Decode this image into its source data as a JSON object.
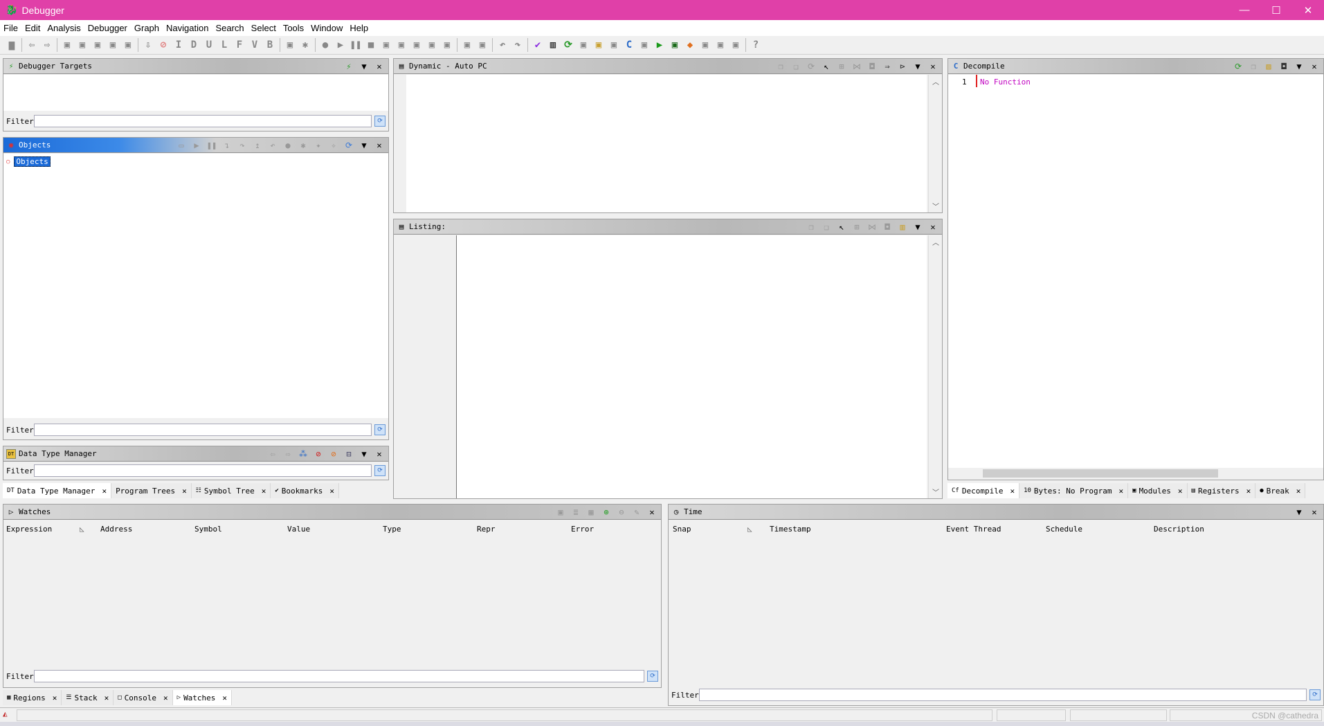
{
  "window": {
    "title": "Debugger",
    "minimize": "—",
    "maximize": "☐",
    "close": "✕"
  },
  "menu": [
    "File",
    "Edit",
    "Analysis",
    "Debugger",
    "Graph",
    "Navigation",
    "Search",
    "Select",
    "Tools",
    "Window",
    "Help"
  ],
  "toolbar": [
    "save-icon",
    "|",
    "back-icon",
    "forward-icon",
    "|",
    "program-icon",
    "program-up-icon",
    "program-down-icon",
    "program-next-icon",
    "program-prev-icon",
    "|",
    "next-arrow-icon",
    "stop-red-icon",
    "I",
    "D",
    "U",
    "L",
    "F",
    "V",
    "B",
    "|",
    "script-icon",
    "bug-icon",
    "|",
    "record-icon",
    "resume-icon",
    "pause-icon",
    "stop-icon",
    "disconnect-icon",
    "step-into-icon",
    "step-over-icon",
    "step-out-icon",
    "step-last-icon",
    "|",
    "sync-icon",
    "sync2-icon",
    "|",
    "undo-icon",
    "redo-icon",
    "|",
    "check-icon",
    "bytes-icon",
    "refresh-green-icon",
    "list-icon",
    "folder-icon",
    "table-icon",
    "decompile-icon",
    "tree-icon",
    "run-green-icon",
    "terminal-icon",
    "diamond-icon",
    "grid-icon",
    "image-icon",
    "network-icon",
    "|",
    "help-icon"
  ],
  "targets": {
    "title": "Debugger Targets",
    "filter_label": "Filter:"
  },
  "objects": {
    "title": "Objects",
    "tree_item": "Objects",
    "filter_label": "Filter:"
  },
  "dtm": {
    "title": "Data Type Manager",
    "filter_label": "Filter:"
  },
  "left_tabs": [
    {
      "label": "Data Type Manager",
      "icon": "DT",
      "selected": true
    },
    {
      "label": "Program Trees",
      "icon": "",
      "selected": false
    },
    {
      "label": "Symbol Tree",
      "icon": "☷",
      "selected": false
    },
    {
      "label": "Bookmarks",
      "icon": "✔",
      "selected": false
    }
  ],
  "dynamic": {
    "title": "Dynamic - Auto PC"
  },
  "listing": {
    "title": "Listing:"
  },
  "decompile": {
    "title": "Decompile",
    "line_number": "1",
    "line_text": "No Function"
  },
  "right_tabs": [
    {
      "label": "Decompile",
      "icon": "Cf",
      "selected": true
    },
    {
      "label": "Bytes: No Program",
      "icon": "10",
      "selected": false
    },
    {
      "label": "Modules",
      "icon": "▣",
      "selected": false
    },
    {
      "label": "Registers",
      "icon": "▤",
      "selected": false
    },
    {
      "label": "Break",
      "icon": "●",
      "selected": false
    }
  ],
  "watches": {
    "title": "Watches",
    "columns": [
      "Expression",
      "Address",
      "Symbol",
      "Value",
      "Type",
      "Repr",
      "Error"
    ],
    "filter_label": "Filter:"
  },
  "time": {
    "title": "Time",
    "columns": [
      "Snap",
      "Timestamp",
      "Event Thread",
      "Schedule",
      "Description"
    ],
    "filter_label": "Filter:"
  },
  "bottom_tabs": [
    {
      "label": "Regions",
      "icon": "▦",
      "selected": false
    },
    {
      "label": "Stack",
      "icon": "☰",
      "selected": false
    },
    {
      "label": "Console",
      "icon": "□",
      "selected": false
    },
    {
      "label": "Watches",
      "icon": "▷",
      "selected": true
    }
  ],
  "status": {
    "watermark": "CSDN @cathedra"
  },
  "colors": {
    "titlebar": "#e040a8",
    "selection": "#1a6ad8",
    "decompile_text": "#c000c0"
  }
}
